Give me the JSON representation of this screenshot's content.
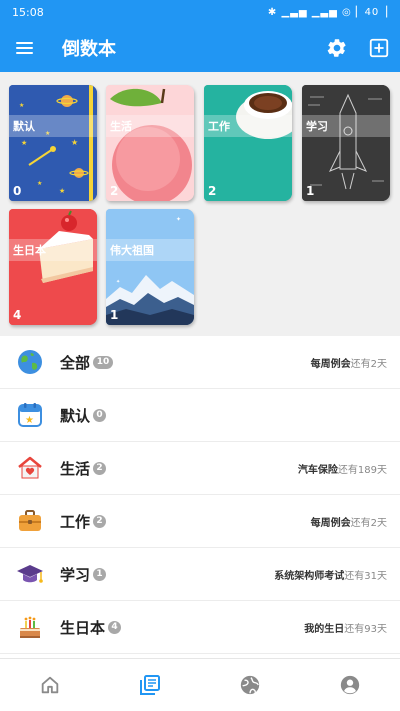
{
  "status": {
    "time": "15:08",
    "system": "✱ ▁▃▅ ▁▃▅ ◎ ▏40▕"
  },
  "app": {
    "title": "倒数本"
  },
  "colors": {
    "primary": "#2196f3",
    "nav_active": "#2196f3",
    "nav_inactive": "#8a8a8a"
  },
  "books": [
    {
      "name": "默认",
      "count": "0"
    },
    {
      "name": "生活",
      "count": "2"
    },
    {
      "name": "工作",
      "count": "2"
    },
    {
      "name": "学习",
      "count": "1"
    },
    {
      "name": "生日本",
      "count": "4"
    },
    {
      "name": "伟大祖国",
      "count": "1"
    }
  ],
  "categories": [
    {
      "label": "全部",
      "badge": "10",
      "icon": "globe-icon",
      "event": "每周例会",
      "remain": "还有2天"
    },
    {
      "label": "默认",
      "badge": "0",
      "icon": "calendar-star-icon",
      "event": "",
      "remain": ""
    },
    {
      "label": "生活",
      "badge": "2",
      "icon": "house-heart-icon",
      "event": "汽车保险",
      "remain": "还有189天"
    },
    {
      "label": "工作",
      "badge": "2",
      "icon": "briefcase-icon",
      "event": "每周例会",
      "remain": "还有2天"
    },
    {
      "label": "学习",
      "badge": "1",
      "icon": "graduation-cap-icon",
      "event": "系统架构师考试",
      "remain": "还有31天"
    },
    {
      "label": "生日本",
      "badge": "4",
      "icon": "birthday-cake-icon",
      "event": "我的生日",
      "remain": "还有93天"
    }
  ],
  "nav": [
    {
      "icon": "home-icon",
      "active": false
    },
    {
      "icon": "book-list-icon",
      "active": true
    },
    {
      "icon": "globe-icon",
      "active": false
    },
    {
      "icon": "account-icon",
      "active": false
    }
  ]
}
